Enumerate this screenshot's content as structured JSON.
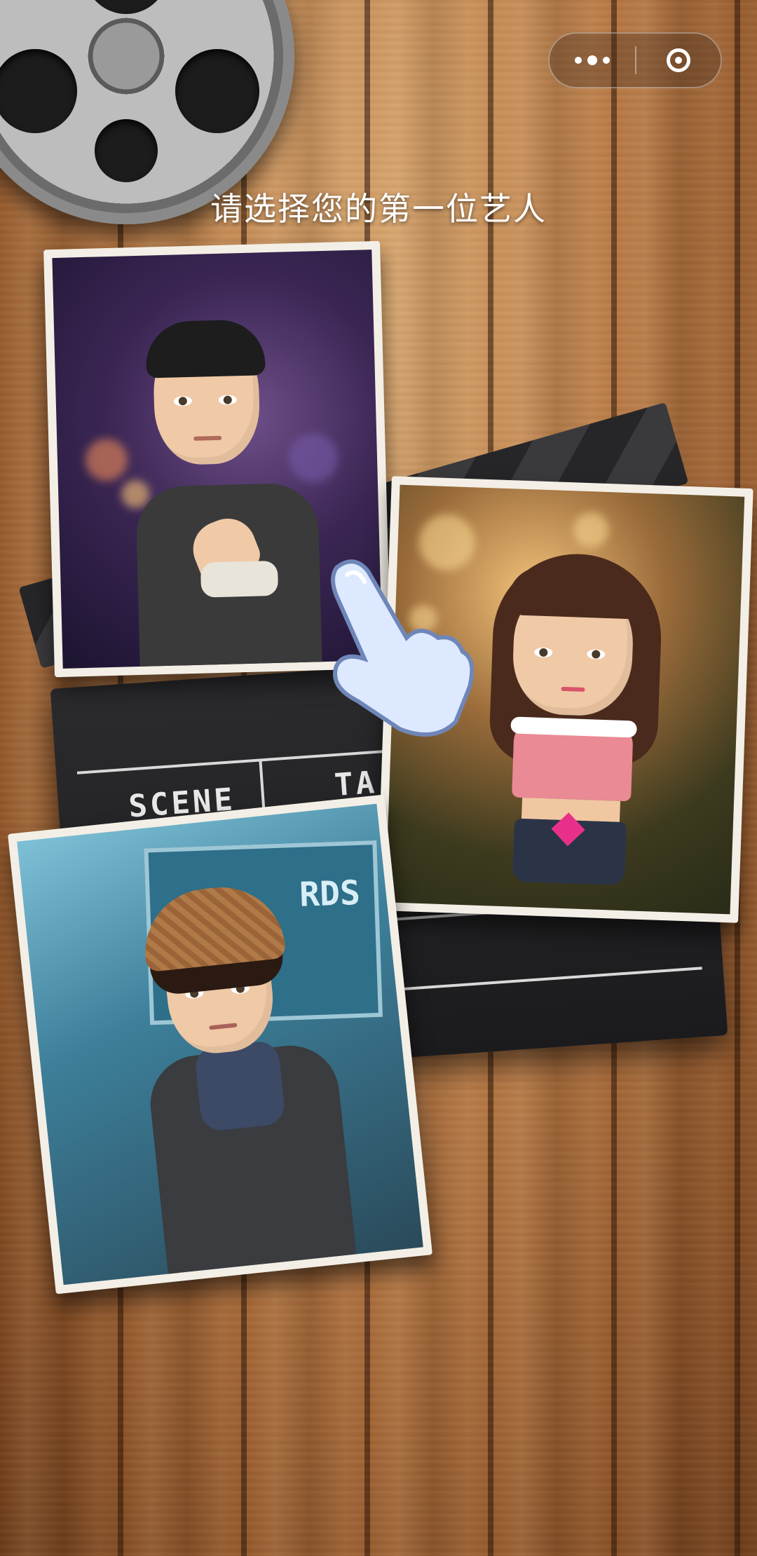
{
  "screen": {
    "title": "请选择您的第一位艺人"
  },
  "capsule": {
    "more_icon": "more-dots-icon",
    "close_icon": "target-close-icon"
  },
  "clapperboard": {
    "scene_label": "SCENE",
    "take_label": "TA"
  },
  "cards": [
    {
      "id": "artist-kungfu",
      "sign_text": ""
    },
    {
      "id": "artist-singer",
      "sign_text": ""
    },
    {
      "id": "artist-detective",
      "sign_text": "RDS"
    }
  ],
  "colors": {
    "wood": "#b97a45",
    "title_text": "#ffffff",
    "card_frame": "#f3efe6"
  }
}
